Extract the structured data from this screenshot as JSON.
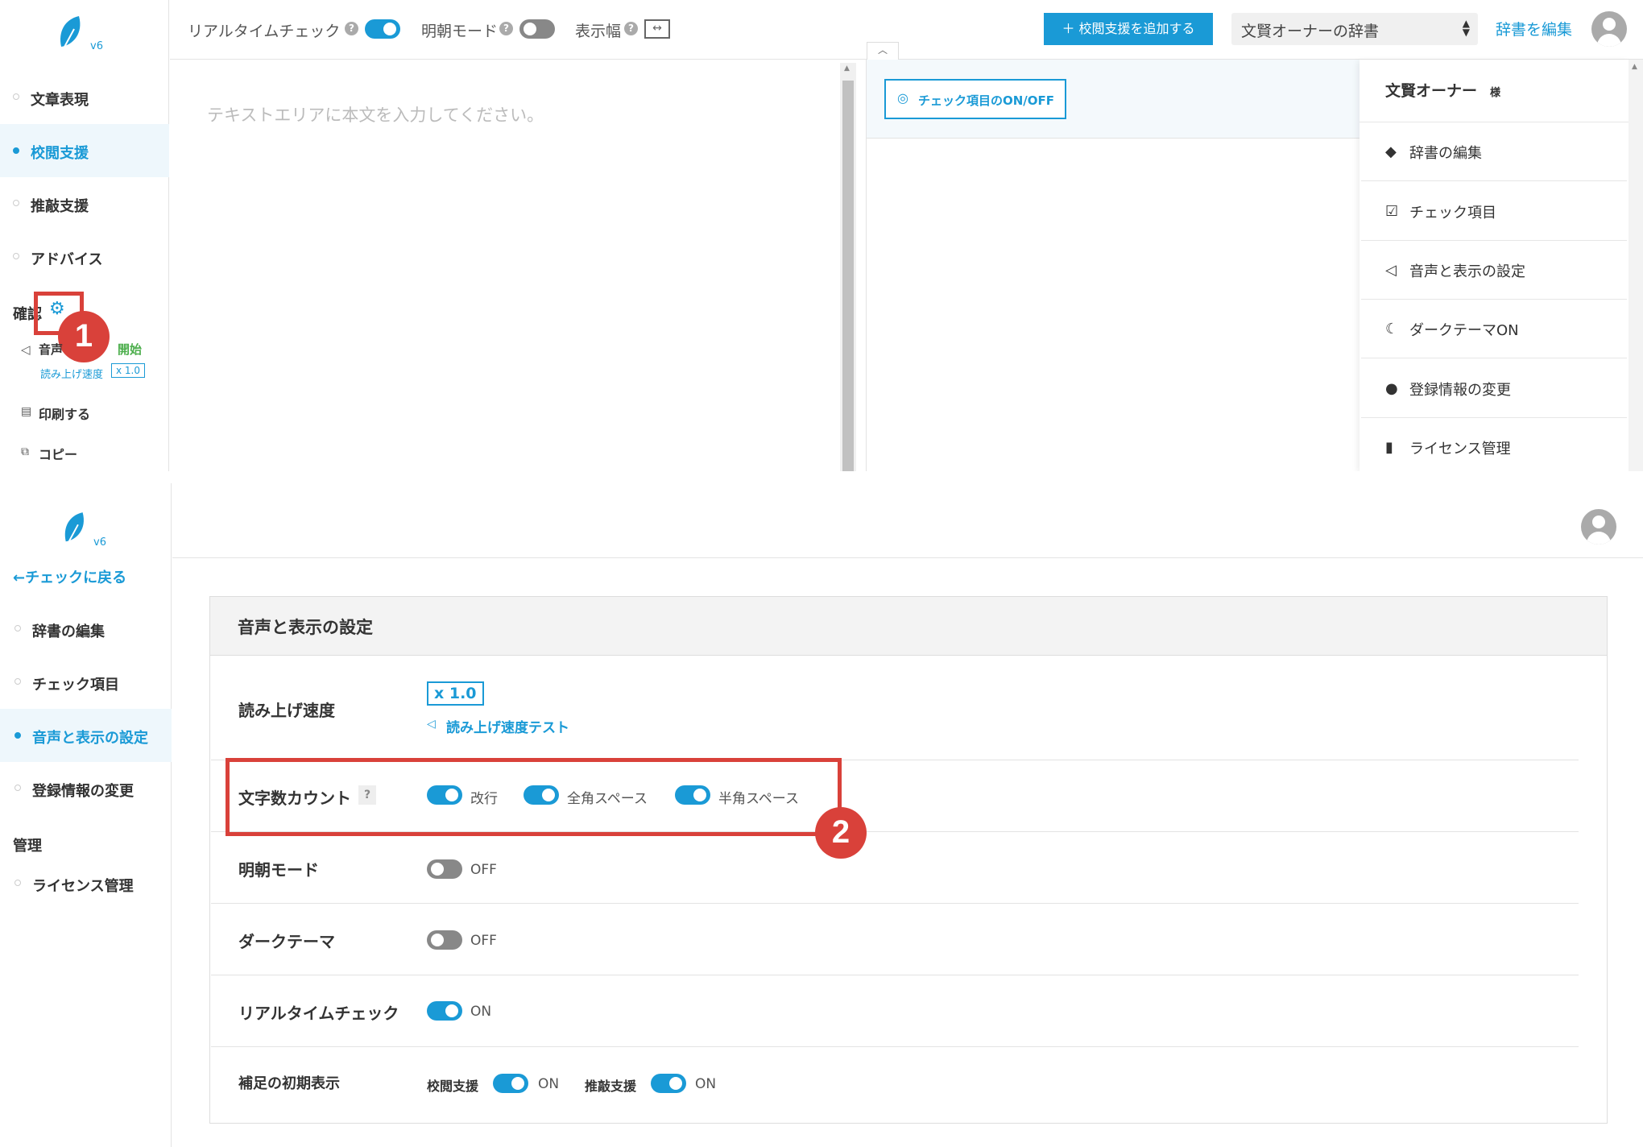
{
  "top": {
    "logo_version": "v6",
    "toolbar": {
      "realtime_label": "リアルタイムチェック",
      "mincho_label": "明朝モード",
      "width_label": "表示幅",
      "add_button": "＋ 校閲支援を追加する",
      "dictionary_select": "文賢オーナーの辞書",
      "edit_dictionary_link": "辞書を編集"
    },
    "sidebar": {
      "items": [
        {
          "label": "文章表現",
          "active": false
        },
        {
          "label": "校閲支援",
          "active": true
        },
        {
          "label": "推敲支援",
          "active": false
        },
        {
          "label": "アドバイス",
          "active": false
        }
      ],
      "confirm_label": "確認",
      "speech_label": "音声",
      "speech_start": "開始",
      "read_speed_label": "読み上げ速度",
      "read_speed_value": "x 1.0",
      "print_label": "印刷する",
      "copy_label": "コピー"
    },
    "editor_placeholder": "テキストエリアに本文を入力してください。",
    "check_toggle_button": "チェック項目のON/OFF",
    "user_menu": {
      "owner_name": "文賢オーナー",
      "owner_suffix": "様",
      "items": [
        {
          "label": "辞書の編集",
          "icon": "eraser-icon"
        },
        {
          "label": "チェック項目",
          "icon": "checkbox-icon"
        },
        {
          "label": "音声と表示の設定",
          "icon": "speaker-icon"
        },
        {
          "label": "ダークテーマON",
          "icon": "moon-icon"
        },
        {
          "label": "登録情報の変更",
          "icon": "user-circle-icon"
        },
        {
          "label": "ライセンス管理",
          "icon": "id-card-icon"
        }
      ]
    },
    "badge_1": "1"
  },
  "bottom": {
    "logo_version": "v6",
    "back_link": "←チェックに戻る",
    "sidebar": {
      "items": [
        {
          "label": "辞書の編集",
          "active": false
        },
        {
          "label": "チェック項目",
          "active": false
        },
        {
          "label": "音声と表示の設定",
          "active": true
        },
        {
          "label": "登録情報の変更",
          "active": false
        }
      ],
      "manage_heading": "管理",
      "license_item": "ライセンス管理"
    },
    "panel_title": "音声と表示の設定",
    "read_speed": {
      "label": "読み上げ速度",
      "value": "x 1.0",
      "test_link": "読み上げ速度テスト"
    },
    "char_count": {
      "label": "文字数カウント",
      "help": "?",
      "options": [
        "改行",
        "全角スペース",
        "半角スペース"
      ]
    },
    "mincho": {
      "label": "明朝モード",
      "state": "OFF"
    },
    "dark": {
      "label": "ダークテーマ",
      "state": "OFF"
    },
    "realtime": {
      "label": "リアルタイムチェック",
      "state": "ON"
    },
    "supplement": {
      "label": "補足の初期表示",
      "a_label": "校閲支援",
      "a_state": "ON",
      "b_label": "推敲支援",
      "b_state": "ON"
    },
    "badge_2": "2"
  },
  "colors": {
    "accent": "#1a9ad6",
    "badge": "#d9413a"
  }
}
